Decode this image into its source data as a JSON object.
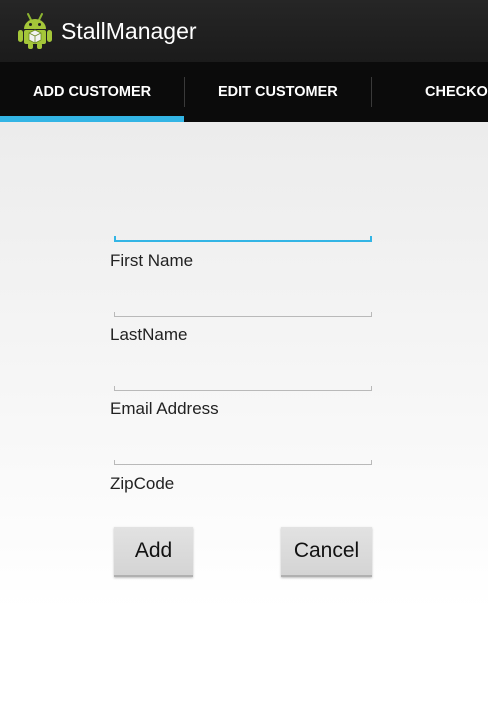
{
  "app": {
    "title": "StallManager",
    "icon": "android-robot-icon",
    "accent_color": "#33b5e5",
    "icon_color": "#a4c639"
  },
  "tabs": [
    {
      "label": "ADD CUSTOMER",
      "selected": true
    },
    {
      "label": "EDIT CUSTOMER",
      "selected": false
    },
    {
      "label": "CHECKOUT",
      "selected": false
    }
  ],
  "form": {
    "fields": [
      {
        "label": "First Name",
        "value": "",
        "focused": true
      },
      {
        "label": "LastName",
        "value": "",
        "focused": false
      },
      {
        "label": "Email Address",
        "value": "",
        "focused": false
      },
      {
        "label": "ZipCode",
        "value": "",
        "focused": false
      }
    ],
    "add_label": "Add",
    "cancel_label": "Cancel"
  }
}
